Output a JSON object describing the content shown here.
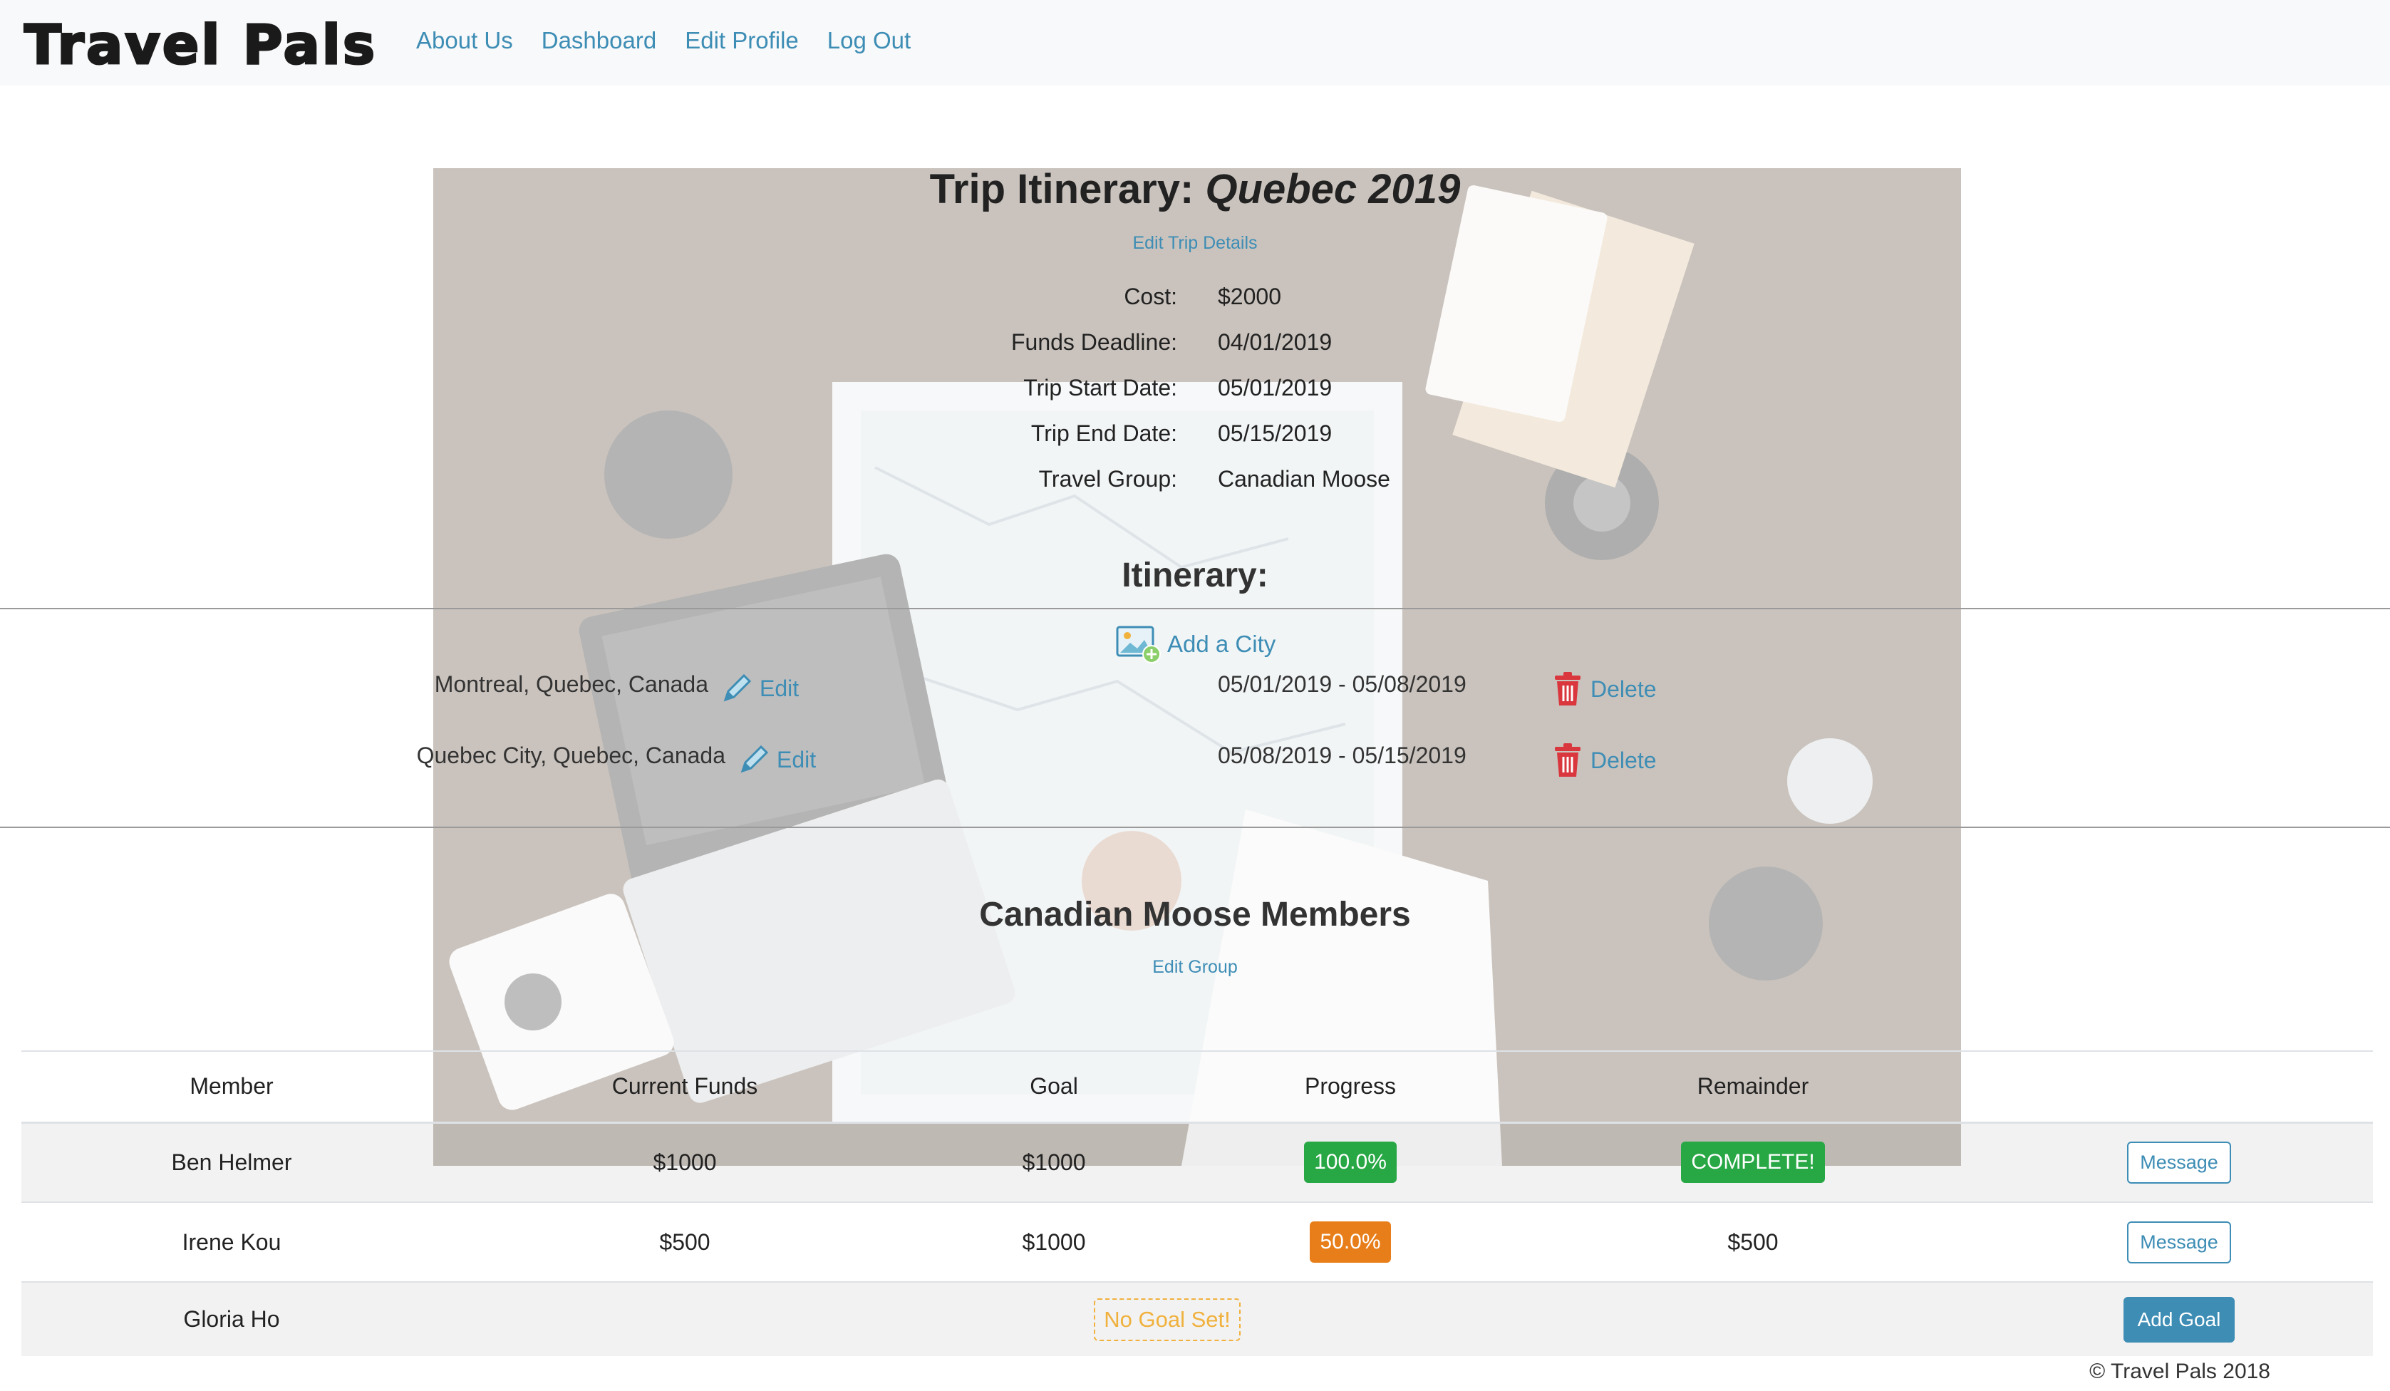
{
  "navbar": {
    "brand": "Travel Pals",
    "links": [
      "About Us",
      "Dashboard",
      "Edit Profile",
      "Log Out"
    ]
  },
  "trip": {
    "title_prefix": "Trip Itinerary: ",
    "name": "Quebec 2019",
    "edit_link": "Edit Trip Details",
    "details": [
      {
        "label": "Cost:",
        "value": "$2000"
      },
      {
        "label": "Funds Deadline:",
        "value": "04/01/2019"
      },
      {
        "label": "Trip Start Date:",
        "value": "05/01/2019"
      },
      {
        "label": "Trip End Date:",
        "value": "05/15/2019"
      },
      {
        "label": "Travel Group:",
        "value": "Canadian Moose"
      }
    ]
  },
  "itinerary": {
    "heading": "Itinerary:",
    "add_city_label": "Add a City",
    "cities": [
      {
        "name": "Montreal, Quebec, Canada",
        "edit_label": "Edit",
        "dates": "05/01/2019 - 05/08/2019",
        "delete_label": "Delete"
      },
      {
        "name": "Quebec City, Quebec, Canada",
        "edit_label": "Edit",
        "dates": "05/08/2019 - 05/15/2019",
        "delete_label": "Delete"
      }
    ]
  },
  "members": {
    "heading": "Canadian Moose Members",
    "edit_link": "Edit Group",
    "columns": [
      "Member",
      "Current Funds",
      "Goal",
      "Progress",
      "Remainder",
      ""
    ],
    "rows": [
      {
        "member": "Ben Helmer",
        "current_funds": "$1000",
        "goal": "$1000",
        "progress": "100.0%",
        "remainder": "COMPLETE!",
        "action": "Message"
      },
      {
        "member": "Irene Kou",
        "current_funds": "$500",
        "goal": "$1000",
        "progress": "50.0%",
        "remainder": "$500",
        "action": "Message"
      },
      {
        "member": "Gloria Ho",
        "no_goal": "No Goal Set!",
        "action": "Add Goal"
      }
    ]
  },
  "footer": "© Travel Pals 2018",
  "colors": {
    "link": "#3d8db5",
    "success": "#28a745",
    "warning": "#e87e19",
    "no_goal": "#f0b13d",
    "delete_icon": "#d9363e"
  }
}
